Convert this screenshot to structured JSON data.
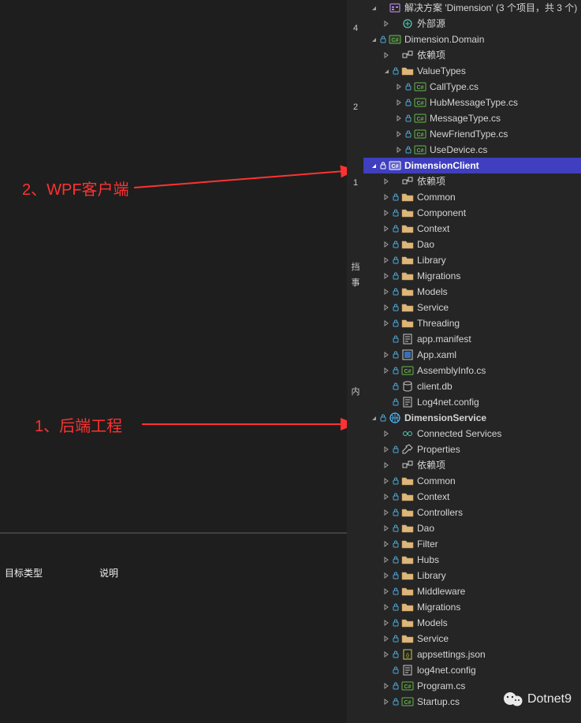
{
  "annotations": {
    "client": "2、WPF客户端",
    "backend": "1、后端工程"
  },
  "bottom": {
    "col1": "目标类型",
    "col2": "说明"
  },
  "sidebar_stub": {
    "char1": "4",
    "char2": "2",
    "char3": "1",
    "char4": "挡",
    "char5": "事",
    "char6": "内"
  },
  "watermark": "Dotnet9",
  "solution": {
    "title": "解决方案 'Dimension' (3 个项目，共 3 个)"
  },
  "external": "外部源",
  "tree": [
    {
      "indent": 0,
      "expander": "open",
      "lock": false,
      "icon": "solution",
      "labelPath": "solution.title"
    },
    {
      "indent": 1,
      "expander": "right",
      "lock": false,
      "icon": "external",
      "label": "外部源"
    },
    {
      "indent": 0,
      "expander": "open",
      "lock": true,
      "icon": "csproj",
      "label": "Dimension.Domain"
    },
    {
      "indent": 1,
      "expander": "right",
      "lock": false,
      "icon": "dependency",
      "label": "依赖项"
    },
    {
      "indent": 1,
      "expander": "open",
      "lock": true,
      "icon": "folder",
      "label": "ValueTypes"
    },
    {
      "indent": 2,
      "expander": "right",
      "lock": true,
      "icon": "cs",
      "label": "CallType.cs"
    },
    {
      "indent": 2,
      "expander": "right",
      "lock": true,
      "icon": "cs",
      "label": "HubMessageType.cs"
    },
    {
      "indent": 2,
      "expander": "right",
      "lock": true,
      "icon": "cs",
      "label": "MessageType.cs"
    },
    {
      "indent": 2,
      "expander": "right",
      "lock": true,
      "icon": "cs",
      "label": "NewFriendType.cs"
    },
    {
      "indent": 2,
      "expander": "right",
      "lock": true,
      "icon": "cs",
      "label": "UseDevice.cs"
    },
    {
      "indent": 0,
      "expander": "open",
      "lock": true,
      "icon": "csproj-sel",
      "label": "DimensionClient",
      "selected": true,
      "bold": true
    },
    {
      "indent": 1,
      "expander": "right",
      "lock": false,
      "icon": "dependency",
      "label": "依赖项"
    },
    {
      "indent": 1,
      "expander": "right",
      "lock": true,
      "icon": "folder",
      "label": "Common"
    },
    {
      "indent": 1,
      "expander": "right",
      "lock": true,
      "icon": "folder",
      "label": "Component"
    },
    {
      "indent": 1,
      "expander": "right",
      "lock": true,
      "icon": "folder",
      "label": "Context"
    },
    {
      "indent": 1,
      "expander": "right",
      "lock": true,
      "icon": "folder",
      "label": "Dao"
    },
    {
      "indent": 1,
      "expander": "right",
      "lock": true,
      "icon": "folder",
      "label": "Library"
    },
    {
      "indent": 1,
      "expander": "right",
      "lock": true,
      "icon": "folder",
      "label": "Migrations"
    },
    {
      "indent": 1,
      "expander": "right",
      "lock": true,
      "icon": "folder",
      "label": "Models"
    },
    {
      "indent": 1,
      "expander": "right",
      "lock": true,
      "icon": "folder",
      "label": "Service"
    },
    {
      "indent": 1,
      "expander": "right",
      "lock": true,
      "icon": "folder",
      "label": "Threading"
    },
    {
      "indent": 1,
      "expander": "none",
      "lock": true,
      "icon": "config",
      "label": "app.manifest"
    },
    {
      "indent": 1,
      "expander": "right",
      "lock": true,
      "icon": "xaml",
      "label": "App.xaml"
    },
    {
      "indent": 1,
      "expander": "right",
      "lock": true,
      "icon": "cs",
      "label": "AssemblyInfo.cs"
    },
    {
      "indent": 1,
      "expander": "none",
      "lock": true,
      "icon": "db",
      "label": "client.db"
    },
    {
      "indent": 1,
      "expander": "none",
      "lock": true,
      "icon": "config",
      "label": "Log4net.config"
    },
    {
      "indent": 0,
      "expander": "open",
      "lock": true,
      "icon": "webproj",
      "label": "DimensionService",
      "bold": true
    },
    {
      "indent": 1,
      "expander": "right",
      "lock": false,
      "icon": "connected",
      "label": "Connected Services"
    },
    {
      "indent": 1,
      "expander": "right",
      "lock": true,
      "icon": "properties",
      "label": "Properties"
    },
    {
      "indent": 1,
      "expander": "right",
      "lock": false,
      "icon": "dependency",
      "label": "依赖项"
    },
    {
      "indent": 1,
      "expander": "right",
      "lock": true,
      "icon": "folder",
      "label": "Common"
    },
    {
      "indent": 1,
      "expander": "right",
      "lock": true,
      "icon": "folder",
      "label": "Context"
    },
    {
      "indent": 1,
      "expander": "right",
      "lock": true,
      "icon": "folder",
      "label": "Controllers"
    },
    {
      "indent": 1,
      "expander": "right",
      "lock": true,
      "icon": "folder",
      "label": "Dao"
    },
    {
      "indent": 1,
      "expander": "right",
      "lock": true,
      "icon": "folder",
      "label": "Filter"
    },
    {
      "indent": 1,
      "expander": "right",
      "lock": true,
      "icon": "folder",
      "label": "Hubs"
    },
    {
      "indent": 1,
      "expander": "right",
      "lock": true,
      "icon": "folder",
      "label": "Library"
    },
    {
      "indent": 1,
      "expander": "right",
      "lock": true,
      "icon": "folder",
      "label": "Middleware"
    },
    {
      "indent": 1,
      "expander": "right",
      "lock": true,
      "icon": "folder",
      "label": "Migrations"
    },
    {
      "indent": 1,
      "expander": "right",
      "lock": true,
      "icon": "folder",
      "label": "Models"
    },
    {
      "indent": 1,
      "expander": "right",
      "lock": true,
      "icon": "folder",
      "label": "Service"
    },
    {
      "indent": 1,
      "expander": "right",
      "lock": true,
      "icon": "json",
      "label": "appsettings.json"
    },
    {
      "indent": 1,
      "expander": "none",
      "lock": true,
      "icon": "config",
      "label": "log4net.config"
    },
    {
      "indent": 1,
      "expander": "right",
      "lock": true,
      "icon": "cs",
      "label": "Program.cs"
    },
    {
      "indent": 1,
      "expander": "right",
      "lock": true,
      "icon": "cs",
      "label": "Startup.cs"
    }
  ]
}
